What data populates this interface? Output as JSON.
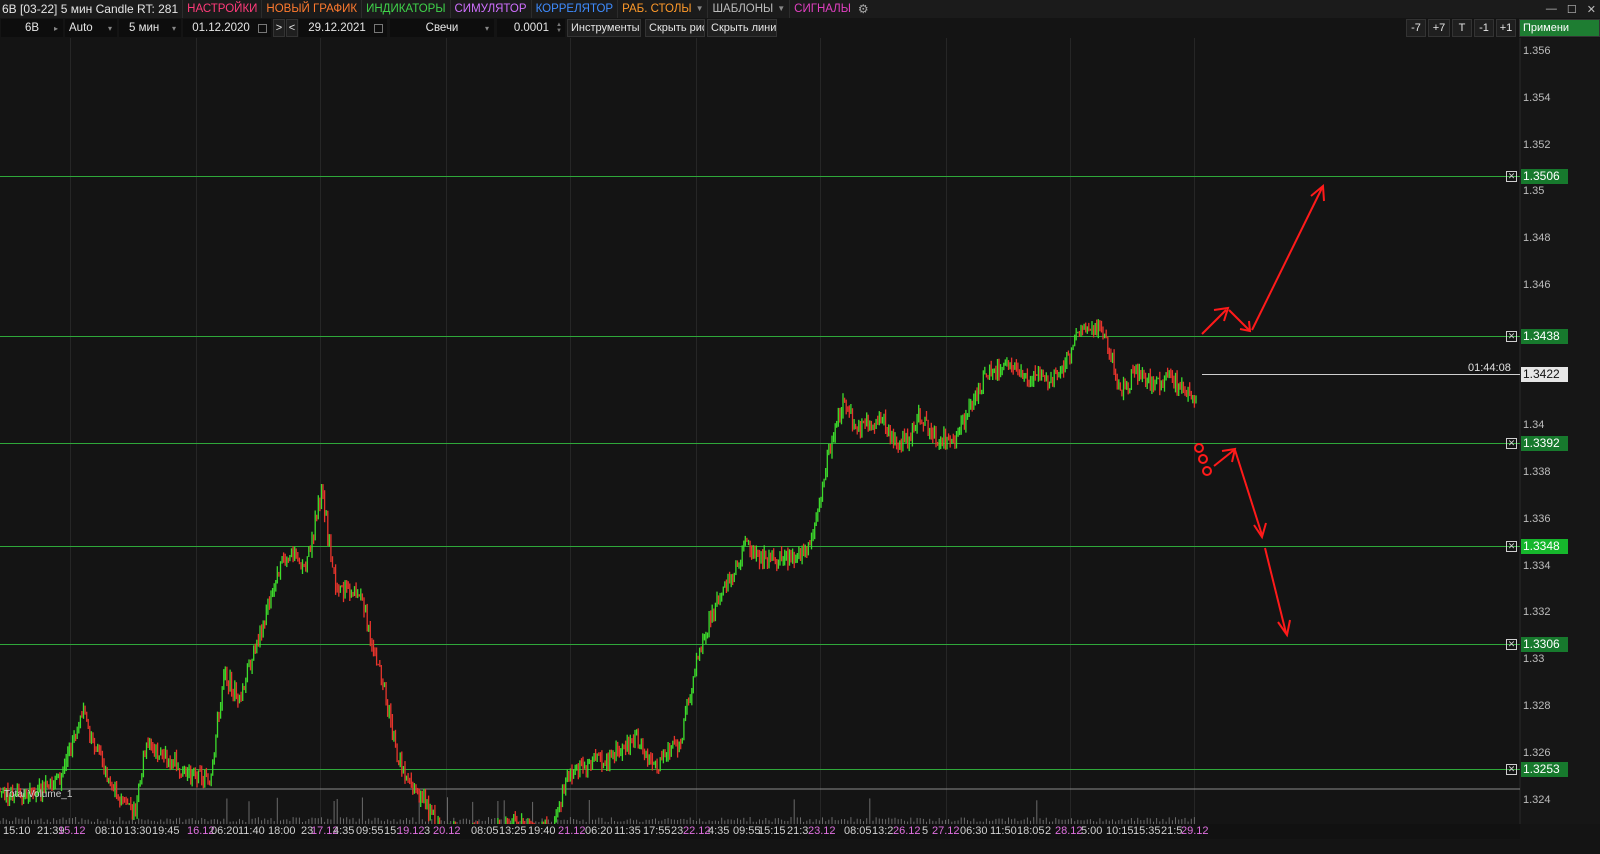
{
  "menubar": {
    "title": "6B [03-22] 5 мин Candle RT: 281",
    "items": [
      {
        "label": "НАСТРОЙКИ",
        "color": "#ff3b7a"
      },
      {
        "label": "НОВЫЙ ГРАФИК",
        "color": "#ff7a2e"
      },
      {
        "label": "ИНДИКАТОРЫ",
        "color": "#3fd24a"
      },
      {
        "label": "СИМУЛЯТОР",
        "color": "#d070ff"
      },
      {
        "label": "КОРРЕЛЯТОР",
        "color": "#3f8cff"
      },
      {
        "label": "РАБ. СТОЛЫ",
        "color": "#ff9a2a"
      },
      {
        "label": "ШАБЛОНЫ",
        "color": "#bbbbbb"
      },
      {
        "label": "СИГНАЛЫ",
        "color": "#e040c0"
      }
    ],
    "gear_icon": "gear-icon"
  },
  "toolbar": {
    "symbol": "6B",
    "scale": "Auto",
    "timeframe": "5 мин",
    "date_from": "01.12.2020",
    "next": ">",
    "prev": "<",
    "date_to": "29.12.2021",
    "chart_type": "Свечи",
    "step": "0.0001",
    "tools": "Инструменты",
    "hide_drawings": "Скрыть рис.",
    "hide_lines": "Скрыть линии",
    "minus7": "-7",
    "plus7": "+7",
    "t": "T",
    "minus1": "-1",
    "plus1": "+1",
    "apply": "Примени"
  },
  "colors": {
    "background": "#141414",
    "up_candle": "#3ddc2c",
    "down_candle": "#e8342c",
    "level_line": "#2fa83a",
    "level_label": "#17792d",
    "arrow": "#ff1a1a"
  },
  "price_axis": {
    "ticks": [
      "1.356",
      "1.354",
      "1.352",
      "1.35",
      "1.348",
      "1.346",
      "1.34",
      "1.338",
      "1.336",
      "1.334",
      "1.332",
      "1.33",
      "1.328",
      "1.326",
      "1.324"
    ],
    "levels": [
      "1.3506",
      "1.3438",
      "1.3392",
      "1.3348",
      "1.3306",
      "1.3253"
    ],
    "current_price": "1.3422",
    "countdown": "01:44:08"
  },
  "volume_panel": {
    "label": "Total Volume_1"
  },
  "time_axis": [
    {
      "text": "15:10",
      "kind": "t"
    },
    {
      "text": "21:39",
      "kind": "t"
    },
    {
      "text": "15.12",
      "kind": "d"
    },
    {
      "text": "08:10",
      "kind": "t"
    },
    {
      "text": "13:30",
      "kind": "t"
    },
    {
      "text": "19:45",
      "kind": "t"
    },
    {
      "text": "16.12",
      "kind": "d"
    },
    {
      "text": "06:20",
      "kind": "t"
    },
    {
      "text": "11:40",
      "kind": "t"
    },
    {
      "text": "18:00",
      "kind": "t"
    },
    {
      "text": "23",
      "kind": "t"
    },
    {
      "text": "17.12",
      "kind": "d"
    },
    {
      "text": "4:35",
      "kind": "t"
    },
    {
      "text": "09:55",
      "kind": "t"
    },
    {
      "text": "15:",
      "kind": "t"
    },
    {
      "text": "19.12",
      "kind": "d"
    },
    {
      "text": "3",
      "kind": "t"
    },
    {
      "text": "20.12",
      "kind": "d"
    },
    {
      "text": "08:05",
      "kind": "t"
    },
    {
      "text": "13:25",
      "kind": "t"
    },
    {
      "text": "19:40",
      "kind": "t"
    },
    {
      "text": "21.12",
      "kind": "d"
    },
    {
      "text": "06:20",
      "kind": "t"
    },
    {
      "text": "11:35",
      "kind": "t"
    },
    {
      "text": "17:55",
      "kind": "t"
    },
    {
      "text": "23",
      "kind": "t"
    },
    {
      "text": "22.12",
      "kind": "d"
    },
    {
      "text": "4:35",
      "kind": "t"
    },
    {
      "text": "09:55",
      "kind": "t"
    },
    {
      "text": "15:15",
      "kind": "t"
    },
    {
      "text": "21:3",
      "kind": "t"
    },
    {
      "text": "23.12",
      "kind": "d"
    },
    {
      "text": "08:05",
      "kind": "t"
    },
    {
      "text": "13:2",
      "kind": "t"
    },
    {
      "text": "26.12",
      "kind": "d"
    },
    {
      "text": "5",
      "kind": "t"
    },
    {
      "text": "27.12",
      "kind": "d"
    },
    {
      "text": "06:30",
      "kind": "t"
    },
    {
      "text": "11:50",
      "kind": "t"
    },
    {
      "text": "18:05",
      "kind": "t"
    },
    {
      "text": "2",
      "kind": "t"
    },
    {
      "text": "28.12",
      "kind": "d"
    },
    {
      "text": "5:00",
      "kind": "t"
    },
    {
      "text": "10:15",
      "kind": "t"
    },
    {
      "text": "15:35",
      "kind": "t"
    },
    {
      "text": "21:5",
      "kind": "t"
    },
    {
      "text": "29.12",
      "kind": "d"
    }
  ],
  "chart_data": {
    "type": "candlestick",
    "symbol": "6B [03-22]",
    "timeframe": "5 мин",
    "ylim": [
      1.3236,
      1.3574
    ],
    "path": [
      [
        0,
        1.325
      ],
      [
        0.02,
        1.3249
      ],
      [
        0.04,
        1.3255
      ],
      [
        0.055,
        1.3285
      ],
      [
        0.065,
        1.3268
      ],
      [
        0.075,
        1.325
      ],
      [
        0.09,
        1.3242
      ],
      [
        0.098,
        1.3272
      ],
      [
        0.11,
        1.3265
      ],
      [
        0.125,
        1.3258
      ],
      [
        0.14,
        1.3254
      ],
      [
        0.15,
        1.33
      ],
      [
        0.16,
        1.329
      ],
      [
        0.175,
        1.332
      ],
      [
        0.19,
        1.3352
      ],
      [
        0.205,
        1.3346
      ],
      [
        0.215,
        1.338
      ],
      [
        0.225,
        1.3336
      ],
      [
        0.24,
        1.3336
      ],
      [
        0.255,
        1.33
      ],
      [
        0.265,
        1.3267
      ],
      [
        0.275,
        1.3252
      ],
      [
        0.285,
        1.3245
      ],
      [
        0.295,
        1.3232
      ],
      [
        0.31,
        1.3231
      ],
      [
        0.325,
        1.3232
      ],
      [
        0.345,
        1.3236
      ],
      [
        0.37,
        1.3233
      ],
      [
        0.38,
        1.3258
      ],
      [
        0.39,
        1.3261
      ],
      [
        0.41,
        1.3265
      ],
      [
        0.425,
        1.3272
      ],
      [
        0.44,
        1.3262
      ],
      [
        0.455,
        1.3272
      ],
      [
        0.465,
        1.3302
      ],
      [
        0.478,
        1.333
      ],
      [
        0.49,
        1.3342
      ],
      [
        0.5,
        1.3358
      ],
      [
        0.51,
        1.335
      ],
      [
        0.52,
        1.335
      ],
      [
        0.535,
        1.335
      ],
      [
        0.545,
        1.3362
      ],
      [
        0.555,
        1.3398
      ],
      [
        0.565,
        1.342
      ],
      [
        0.572,
        1.3406
      ],
      [
        0.582,
        1.3408
      ],
      [
        0.59,
        1.341
      ],
      [
        0.6,
        1.34
      ],
      [
        0.608,
        1.3402
      ],
      [
        0.615,
        1.3412
      ],
      [
        0.628,
        1.34
      ],
      [
        0.64,
        1.3404
      ],
      [
        0.65,
        1.3416
      ],
      [
        0.66,
        1.343
      ],
      [
        0.675,
        1.3433
      ],
      [
        0.69,
        1.3428
      ],
      [
        0.7,
        1.3426
      ],
      [
        0.71,
        1.343
      ],
      [
        0.72,
        1.3445
      ],
      [
        0.732,
        1.3451
      ],
      [
        0.742,
        1.344
      ],
      [
        0.75,
        1.3422
      ],
      [
        0.76,
        1.343
      ],
      [
        0.772,
        1.3425
      ],
      [
        0.782,
        1.3428
      ],
      [
        0.79,
        1.3424
      ],
      [
        0.8,
        1.342
      ]
    ]
  }
}
